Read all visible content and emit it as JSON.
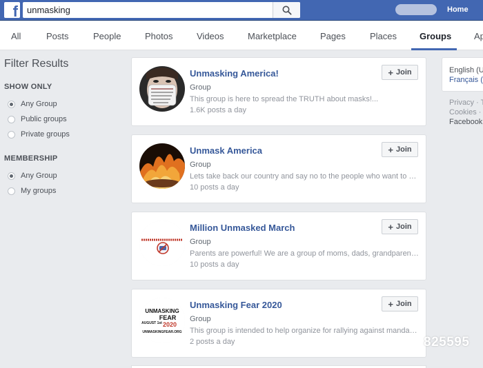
{
  "topbar": {
    "logo": "f",
    "search_value": "unmasking",
    "search_icon": "search-icon",
    "home_label": "Home",
    "brand_color": "#4267b2"
  },
  "tabs": [
    {
      "label": "All"
    },
    {
      "label": "Posts"
    },
    {
      "label": "People"
    },
    {
      "label": "Photos"
    },
    {
      "label": "Videos"
    },
    {
      "label": "Marketplace"
    },
    {
      "label": "Pages"
    },
    {
      "label": "Places"
    },
    {
      "label": "Groups",
      "active": true
    },
    {
      "label": "Ap"
    }
  ],
  "filters": {
    "title": "Filter Results",
    "show_only": {
      "heading": "SHOW ONLY",
      "options": [
        {
          "label": "Any Group",
          "selected": true
        },
        {
          "label": "Public groups",
          "selected": false
        },
        {
          "label": "Private groups",
          "selected": false
        }
      ]
    },
    "membership": {
      "heading": "MEMBERSHIP",
      "options": [
        {
          "label": "Any Group",
          "selected": true
        },
        {
          "label": "My groups",
          "selected": false
        }
      ]
    }
  },
  "results": [
    {
      "name": "Unmasking America!",
      "type": "Group",
      "description": "This group is here to spread the TRUTH about masks!...",
      "activity": "1.6K posts a day",
      "join_label": "Join"
    },
    {
      "name": "Unmask America",
      "type": "Group",
      "description": "Lets take back our country and say no to the people who want to cr...",
      "activity": "10 posts a day",
      "join_label": "Join"
    },
    {
      "name": "Million Unmasked March",
      "type": "Group",
      "description": "Parents are powerful! We are a group of moms, dads, grandparent...",
      "activity": "10 posts a day",
      "join_label": "Join"
    },
    {
      "name": "Unmasking Fear 2020",
      "type": "Group",
      "description": "This group is intended to help organize for rallying against mandato...",
      "activity": "2 posts a day",
      "join_label": "Join",
      "thumb_text": [
        "UNMASKING",
        "FEAR",
        "2020",
        "AUGUST 1st",
        "UNMASKINGFEAR.ORG"
      ]
    }
  ],
  "right_column": {
    "languages": [
      "English (U",
      "Français ("
    ],
    "footer": [
      "Privacy · T",
      "Cookies ·",
      "Facebook"
    ]
  },
  "watermark": "825595"
}
